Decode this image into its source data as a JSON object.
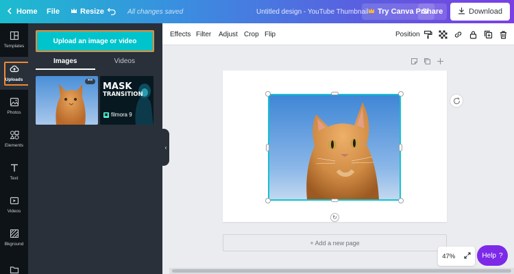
{
  "topbar": {
    "home_label": "Home",
    "file_label": "File",
    "resize_label": "Resize",
    "save_status": "All changes saved",
    "document_title": "Untitled design - YouTube Thumbnail",
    "try_pro_label": "Try Canva Pro",
    "share_label": "Share",
    "download_label": "Download"
  },
  "rail": {
    "items": [
      {
        "label": "Templates",
        "icon": "templates-icon"
      },
      {
        "label": "Uploads",
        "icon": "upload-cloud-icon",
        "active": true
      },
      {
        "label": "Photos",
        "icon": "photos-icon"
      },
      {
        "label": "Elements",
        "icon": "elements-icon"
      },
      {
        "label": "Text",
        "icon": "text-icon"
      },
      {
        "label": "Videos",
        "icon": "video-icon"
      },
      {
        "label": "Bkground",
        "icon": "background-icon"
      },
      {
        "label": "",
        "icon": "folder-icon"
      }
    ]
  },
  "panel": {
    "upload_button": "Upload an image or video",
    "tabs": [
      "Images",
      "Videos"
    ],
    "active_tab": "Images",
    "thumb2_line1": "MASK",
    "thumb2_line2": "TRANSITION",
    "thumb2_brand": "filmora 9",
    "more_glyph": "•••"
  },
  "toolbar": {
    "effects": "Effects",
    "filter": "Filter",
    "adjust": "Adjust",
    "crop": "Crop",
    "flip": "Flip",
    "position": "Position"
  },
  "canvas": {
    "add_page": "+ Add a new page",
    "zoom": "47%",
    "help": "Help",
    "help_glyph": "?"
  },
  "colors": {
    "accent_teal": "#00c4cc",
    "highlight_orange": "#ef8a36",
    "help_purple": "#7d2ae8",
    "selection": "#12c4d0"
  }
}
